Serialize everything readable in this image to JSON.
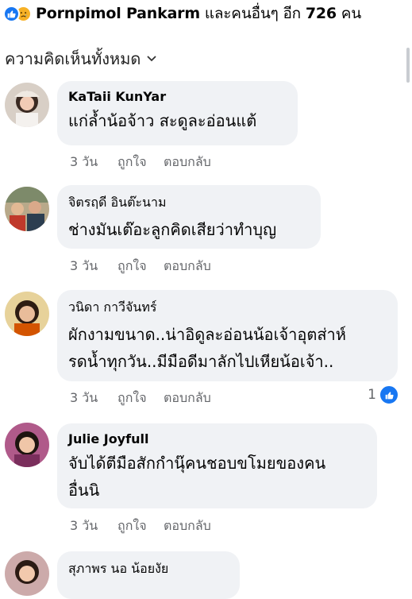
{
  "reactions": {
    "name": "Pornpimol Pankarm",
    "text_middle": "และคนอื่นๆ อีก",
    "count": "726",
    "text_end": "คน"
  },
  "filter": {
    "label": "ความคิดเห็นทั้งหมด"
  },
  "comments": [
    {
      "author": "KaTaii KunYar",
      "lines": [
        "แก่ล้ำน้อจ้าว สะดูละอ่อนแต้"
      ],
      "time": "3 วัน",
      "like": "ถูกใจ",
      "reply": "ตอบกลับ"
    },
    {
      "author": "จิตรฤดี อินต๊ะนาม",
      "lines": [
        "ช่างมันเต๊อะลูกคิดเสียว่าทำบุญ"
      ],
      "time": "3 วัน",
      "like": "ถูกใจ",
      "reply": "ตอบกลับ"
    },
    {
      "author": "วนิดา กาวีจันทร์",
      "lines": [
        "ผักงามขนาด..น่าอิดูละอ่อนน้อเจ้าอุตส่าห์",
        "รดน้ำทุกวัน..มีมือดีมาลักไปเหียน้อเจ้า.."
      ],
      "time": "3 วัน",
      "like": "ถูกใจ",
      "reply": "ตอบกลับ",
      "reaction_count": "1"
    },
    {
      "author": "Julie Joyfull",
      "lines": [
        "จับได้ตีมือสักกำนุ๊คนชอบขโมยของคน",
        "อื่นนิ"
      ],
      "time": "3 วัน",
      "like": "ถูกใจ",
      "reply": "ตอบกลับ"
    },
    {
      "author": "สุภาพร นอ น้อยงัย",
      "lines": []
    }
  ],
  "colors": {
    "bubble": "#f0f2f5",
    "like_blue": "#1877f2",
    "sad_yellow": "#f7b125",
    "meta_gray": "#65676b"
  }
}
